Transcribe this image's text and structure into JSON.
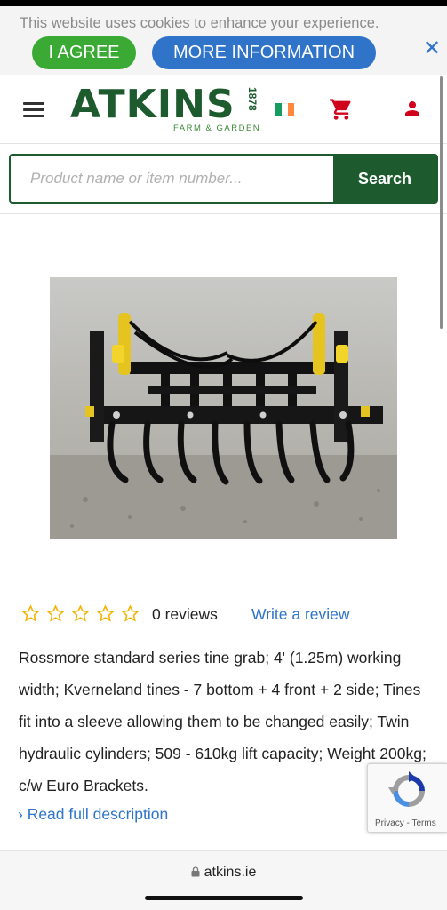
{
  "cookie_banner": {
    "message": "This website uses cookies to enhance your experience.",
    "agree_label": "I AGREE",
    "more_label": "MORE INFORMATION",
    "close_label": "✕"
  },
  "header": {
    "logo_text": "ATKINS",
    "logo_year": "1878",
    "logo_tagline": "FARM & GARDEN",
    "flag_colors": [
      "#169b62",
      "#ffffff",
      "#ff883e"
    ],
    "icons": [
      "menu-icon",
      "ireland-flag-icon",
      "cart-icon",
      "user-icon"
    ]
  },
  "search": {
    "placeholder": "Product name or item number...",
    "button_label": "Search"
  },
  "product": {
    "image_alt": "Tine grab attachment",
    "rating": 0,
    "max_rating": 5,
    "reviews_label": "0 reviews",
    "write_review_label": "Write a review",
    "description": "Rossmore standard series tine grab; 4' (1.25m) working width; Kverneland tines - 7 bottom + 4 front + 2 side; Tines fit into a sleeve allowing them to be changed easily; Twin hydraulic cylinders; 509 - 610kg lift capacity; Weight 200kg; c/w Euro Brackets.",
    "read_more_label": "› Read full description"
  },
  "recaptcha": {
    "links": "Privacy - Terms"
  },
  "browser": {
    "url": "atkins.ie"
  },
  "colors": {
    "brand_green": "#1d5b2f",
    "agree_green": "#3aaa35",
    "link_blue": "#2f74c9",
    "star_yellow": "#f5b301",
    "cart_red": "#d0021b"
  }
}
